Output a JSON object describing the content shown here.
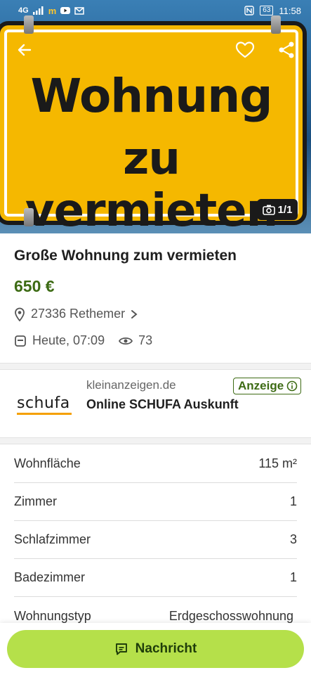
{
  "status_bar": {
    "network": "4G",
    "battery": "63",
    "time": "11:58"
  },
  "hero": {
    "sign_line1": "Wohnung",
    "sign_line2": "zu vermieten",
    "photo_counter": "1/1",
    "sign_color": "#f5b800"
  },
  "listing": {
    "title": "Große Wohnung zum vermieten",
    "price": "650 €",
    "location": "27336 Rethemer",
    "date": "Heute, 07:09",
    "views": "73"
  },
  "ad": {
    "logo": "schufa",
    "domain": "kleinanzeigen.de",
    "title": "Online SCHUFA Auskunft",
    "badge": "Anzeige"
  },
  "details": [
    {
      "label": "Wohnfläche",
      "value": "115 m²"
    },
    {
      "label": "Zimmer",
      "value": "1"
    },
    {
      "label": "Schlafzimmer",
      "value": "3"
    },
    {
      "label": "Badezimmer",
      "value": "1"
    },
    {
      "label": "Wohnungstyp",
      "value": "Erdgeschosswohnung"
    }
  ],
  "cta": {
    "label": "Nachricht",
    "color": "#b5e04a"
  },
  "colors": {
    "price": "#3d6b14",
    "accent": "#b5e04a"
  },
  "icons": [
    "back-arrow-icon",
    "heart-icon",
    "share-icon",
    "camera-icon",
    "location-pin-icon",
    "chevron-right-icon",
    "calendar-icon",
    "eye-icon",
    "info-icon",
    "message-icon"
  ]
}
